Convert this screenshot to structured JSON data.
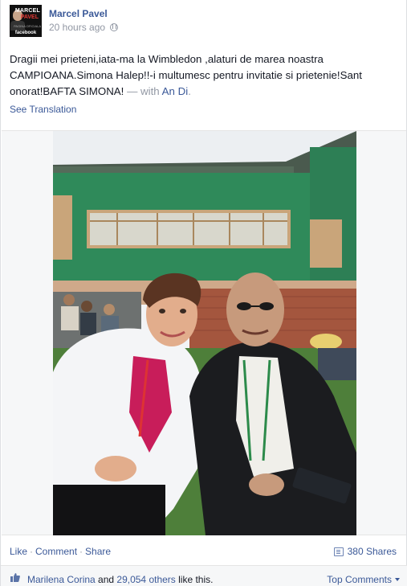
{
  "post": {
    "author": "Marcel Pavel",
    "timestamp": "20 hours ago",
    "avatar_lines": [
      "MARCEL",
      "PAVEL",
      "PAGINA OFICIALA",
      "facebook"
    ],
    "text_main": "Dragii mei prieteni,iata-ma la Wimbledon ,alaturi de marea noastra CAMPIOANA.Simona Halep!!-i multumesc pentru invitatie si prietenie!Sant onorat!BAFTA SIMONA!",
    "with_prefix": " — with ",
    "tagged_person": "An Di",
    "tagged_suffix": ".",
    "see_translation": "See Translation"
  },
  "actions": {
    "like": "Like",
    "comment": "Comment",
    "share": "Share",
    "separator": "·",
    "shares_count": "380 Shares"
  },
  "likes": {
    "first_name": "Marilena Corina",
    "and_text": " and ",
    "others": "29,054 others",
    "suffix": " like this.",
    "top_comments": "Top Comments"
  },
  "colors": {
    "link": "#3b5998",
    "muted": "#9197a3",
    "building_green": "#2f8a5a"
  },
  "icons": [
    "globe-icon",
    "share-icon",
    "thumbs-up-icon",
    "chevron-down-icon"
  ]
}
